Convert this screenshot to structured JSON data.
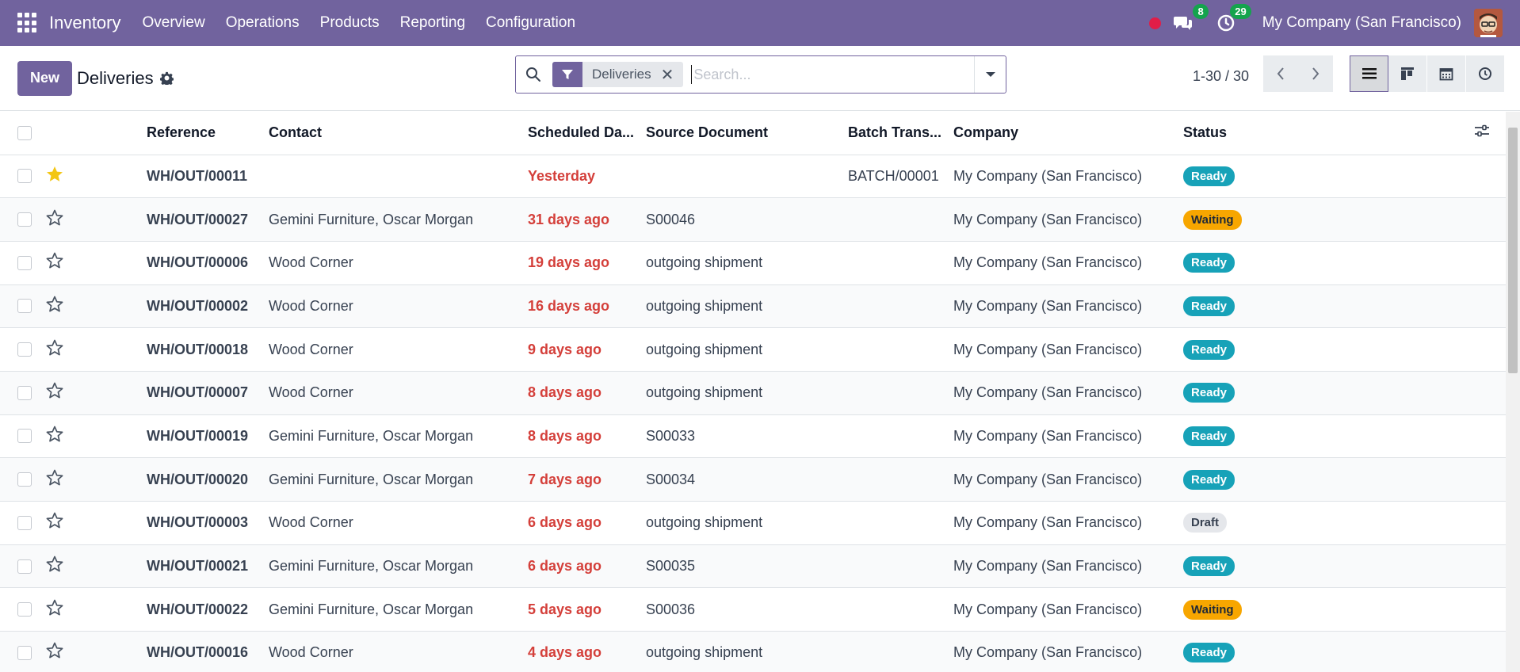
{
  "navbar": {
    "app_name": "Inventory",
    "menu": [
      "Overview",
      "Operations",
      "Products",
      "Reporting",
      "Configuration"
    ],
    "messages_count": "8",
    "activities_count": "29",
    "company": "My Company (San Francisco)"
  },
  "control": {
    "new_label": "New",
    "title": "Deliveries",
    "facet_label": "Deliveries",
    "search_placeholder": "Search...",
    "pager": "1-30 / 30"
  },
  "table": {
    "columns": [
      "Reference",
      "Contact",
      "Scheduled Da...",
      "Source Document",
      "Batch Trans...",
      "Company",
      "Status"
    ],
    "rows": [
      {
        "starred": true,
        "reference": "WH/OUT/00011",
        "contact": "",
        "scheduled": "Yesterday",
        "source": "",
        "batch": "BATCH/00001",
        "company": "My Company (San Francisco)",
        "status": "Ready",
        "status_kind": "ready"
      },
      {
        "starred": false,
        "reference": "WH/OUT/00027",
        "contact": "Gemini Furniture, Oscar Morgan",
        "scheduled": "31 days ago",
        "source": "S00046",
        "batch": "",
        "company": "My Company (San Francisco)",
        "status": "Waiting",
        "status_kind": "waiting"
      },
      {
        "starred": false,
        "reference": "WH/OUT/00006",
        "contact": "Wood Corner",
        "scheduled": "19 days ago",
        "source": "outgoing shipment",
        "batch": "",
        "company": "My Company (San Francisco)",
        "status": "Ready",
        "status_kind": "ready"
      },
      {
        "starred": false,
        "reference": "WH/OUT/00002",
        "contact": "Wood Corner",
        "scheduled": "16 days ago",
        "source": "outgoing shipment",
        "batch": "",
        "company": "My Company (San Francisco)",
        "status": "Ready",
        "status_kind": "ready"
      },
      {
        "starred": false,
        "reference": "WH/OUT/00018",
        "contact": "Wood Corner",
        "scheduled": "9 days ago",
        "source": "outgoing shipment",
        "batch": "",
        "company": "My Company (San Francisco)",
        "status": "Ready",
        "status_kind": "ready"
      },
      {
        "starred": false,
        "reference": "WH/OUT/00007",
        "contact": "Wood Corner",
        "scheduled": "8 days ago",
        "source": "outgoing shipment",
        "batch": "",
        "company": "My Company (San Francisco)",
        "status": "Ready",
        "status_kind": "ready"
      },
      {
        "starred": false,
        "reference": "WH/OUT/00019",
        "contact": "Gemini Furniture, Oscar Morgan",
        "scheduled": "8 days ago",
        "source": "S00033",
        "batch": "",
        "company": "My Company (San Francisco)",
        "status": "Ready",
        "status_kind": "ready"
      },
      {
        "starred": false,
        "reference": "WH/OUT/00020",
        "contact": "Gemini Furniture, Oscar Morgan",
        "scheduled": "7 days ago",
        "source": "S00034",
        "batch": "",
        "company": "My Company (San Francisco)",
        "status": "Ready",
        "status_kind": "ready"
      },
      {
        "starred": false,
        "reference": "WH/OUT/00003",
        "contact": "Wood Corner",
        "scheduled": "6 days ago",
        "source": "outgoing shipment",
        "batch": "",
        "company": "My Company (San Francisco)",
        "status": "Draft",
        "status_kind": "draft"
      },
      {
        "starred": false,
        "reference": "WH/OUT/00021",
        "contact": "Gemini Furniture, Oscar Morgan",
        "scheduled": "6 days ago",
        "source": "S00035",
        "batch": "",
        "company": "My Company (San Francisco)",
        "status": "Ready",
        "status_kind": "ready"
      },
      {
        "starred": false,
        "reference": "WH/OUT/00022",
        "contact": "Gemini Furniture, Oscar Morgan",
        "scheduled": "5 days ago",
        "source": "S00036",
        "batch": "",
        "company": "My Company (San Francisco)",
        "status": "Waiting",
        "status_kind": "waiting"
      },
      {
        "starred": false,
        "reference": "WH/OUT/00016",
        "contact": "Wood Corner",
        "scheduled": "4 days ago",
        "source": "outgoing shipment",
        "batch": "",
        "company": "My Company (San Francisco)",
        "status": "Ready",
        "status_kind": "ready"
      }
    ]
  },
  "colors": {
    "brand": "#71639e",
    "overdue_date": "#d43f3a",
    "ready": "#17a2b8",
    "waiting": "#f7a600",
    "star": "#f3c614"
  }
}
